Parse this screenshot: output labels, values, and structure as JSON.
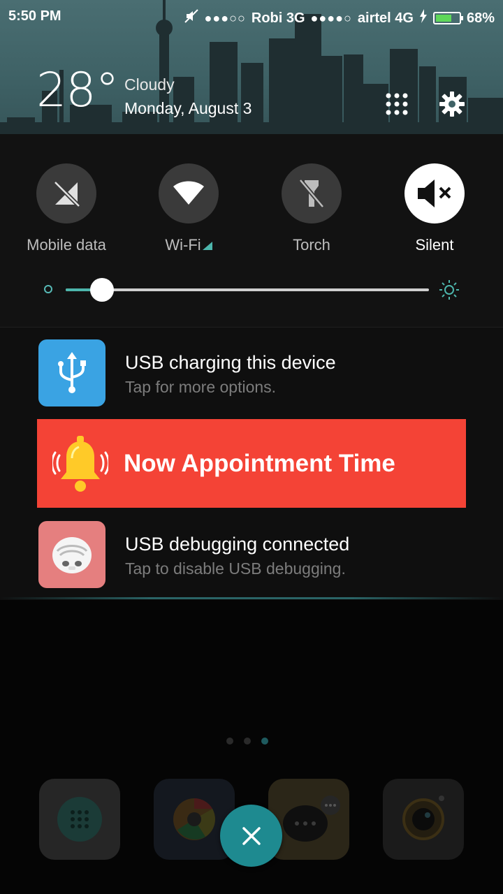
{
  "status_bar": {
    "time": "5:50 PM",
    "carrier1": "Robi 3G",
    "carrier2": "airtel 4G",
    "battery": "68%",
    "battery_level": 0.68
  },
  "weather": {
    "temperature": "28°",
    "condition": "Cloudy",
    "date": "Monday, August 3"
  },
  "quick_settings": {
    "tiles": [
      {
        "label": "Mobile data",
        "icon": "mobile-data-off-icon",
        "active": false
      },
      {
        "label": "Wi-Fi",
        "icon": "wifi-icon",
        "active": false
      },
      {
        "label": "Torch",
        "icon": "torch-off-icon",
        "active": false
      },
      {
        "label": "Silent",
        "icon": "silent-icon",
        "active": true
      }
    ],
    "brightness_level": 0.1
  },
  "notifications": [
    {
      "title": "USB charging this device",
      "subtitle": "Tap for more options.",
      "icon": "usb-icon",
      "icon_color": "#3aa3e3"
    },
    {
      "title": "USB debugging connected",
      "subtitle": "Tap to disable USB debugging.",
      "icon": "debug-bot-icon",
      "icon_color": "#e57f7f"
    }
  ],
  "alert": {
    "text": "Now Appointment Time",
    "color": "#f44336"
  },
  "home": {
    "page_count": 3,
    "current_page": 3,
    "dock": [
      "dialer-icon",
      "browser-icon",
      "messages-icon",
      "camera-icon"
    ]
  },
  "colors": {
    "accent": "#4db6ac",
    "close_button": "#1e8a90"
  }
}
